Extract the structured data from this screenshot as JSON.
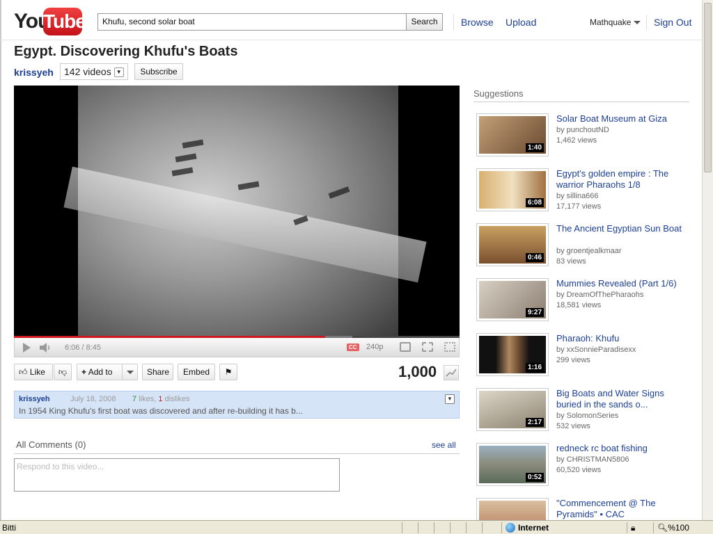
{
  "header": {
    "logo_text_you": "You",
    "logo_text_tube": "Tube",
    "search_value": "Khufu, second solar boat",
    "search_button": "Search",
    "browse": "Browse",
    "upload": "Upload",
    "user": "Mathquake",
    "sign_out": "Sign Out"
  },
  "video": {
    "title": "Egypt. Discovering Khufu's Boats",
    "channel": "krissyeh",
    "video_count": "142 videos",
    "subscribe": "Subscribe",
    "time": "6:06 / 8:45",
    "cc": "CC",
    "quality": "240p",
    "progress_played_fraction": 0.698,
    "progress_loaded_fraction": 0.76
  },
  "actions": {
    "like": "Like",
    "add_to": "Add to",
    "share": "Share",
    "embed": "Embed",
    "views": "1,000"
  },
  "description": {
    "author": "krissyeh",
    "date": "July 18, 2008",
    "likes": "7",
    "likes_word": "likes,",
    "dislikes": "1",
    "dislikes_word": "dislikes",
    "text": "In 1954 King Khufu's first boat was discovered and after re-building it has b..."
  },
  "comments": {
    "heading": "All Comments (0)",
    "see_all": "see all",
    "placeholder": "Respond to this video..."
  },
  "suggestions": {
    "heading": "Suggestions",
    "items": [
      {
        "title": "Solar Boat Museum at Giza",
        "by": "by punchoutND",
        "views": "1,462 views",
        "duration": "1:40",
        "color": "#8a6a4a"
      },
      {
        "title": "Egypt's golden empire : The warrior Pharaohs 1/8",
        "by": "by sillina666",
        "views": "17,177 views",
        "duration": "6:08",
        "color": "#b08850"
      },
      {
        "title": "The Ancient Egyptian Sun Boat",
        "by": "by groentjealkmaar",
        "views": "83 views",
        "duration": "0:46",
        "color": "#7a5030"
      },
      {
        "title": "Mummies Revealed (Part 1/6)",
        "by": "by DreamOfThePharaohs",
        "views": "18,581 views",
        "duration": "9:27",
        "color": "#a89888"
      },
      {
        "title": "Pharaoh: Khufu",
        "by": "by xxSonnieParadisexx",
        "views": "299 views",
        "duration": "1:16",
        "color": "#5a4030"
      },
      {
        "title": "Big Boats and Water Signs buried in the sands o...",
        "by": "by SolomonSeries",
        "views": "532 views",
        "duration": "2:17",
        "color": "#9c9280"
      },
      {
        "title": "redneck rc boat fishing",
        "by": "by CHRISTMAN5806",
        "views": "60,520 views",
        "duration": "0:52",
        "color": "#6a8a9a"
      },
      {
        "title": "\"Commencement @ The Pyramids\" • CAC",
        "by": "",
        "views": "",
        "duration": "",
        "color": "#b07050"
      }
    ]
  },
  "statusbar": {
    "left_text": "Bitti",
    "zone": "Internet",
    "zoom": "%100"
  }
}
